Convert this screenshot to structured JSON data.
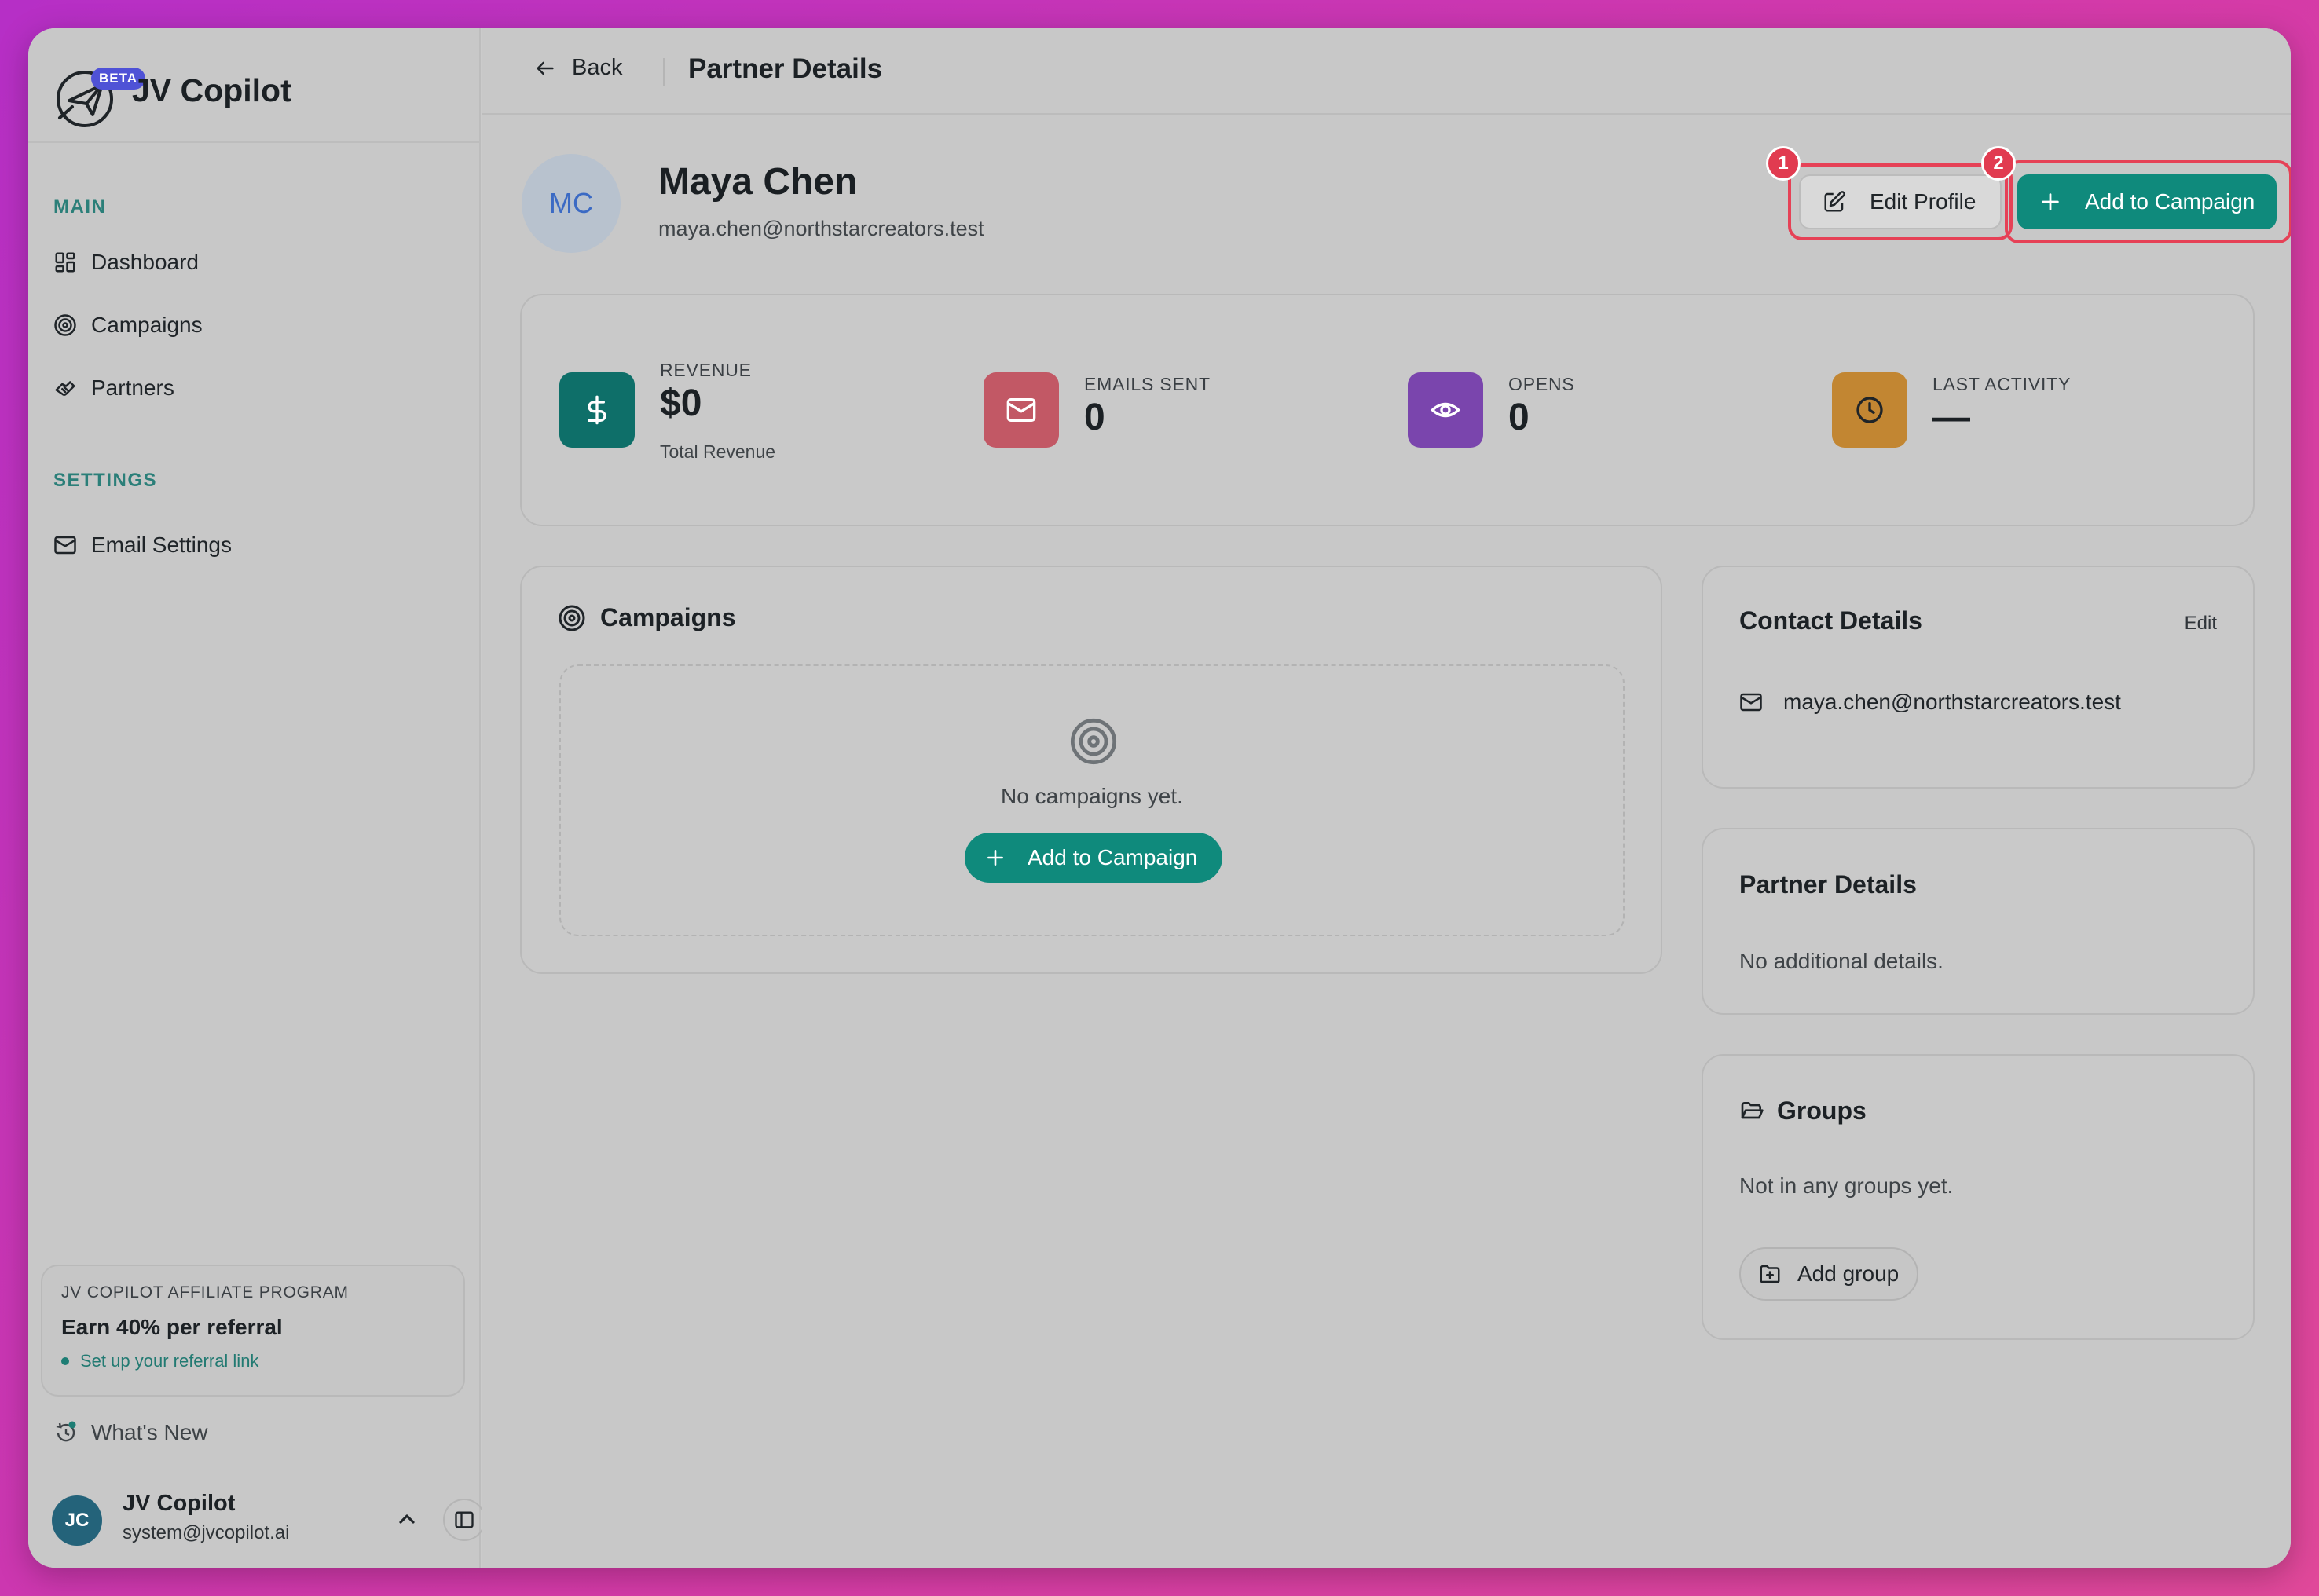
{
  "app": {
    "name": "JV Copilot",
    "beta_badge": "BETA"
  },
  "sidebar": {
    "main_label": "MAIN",
    "settings_label": "SETTINGS",
    "items": [
      {
        "label": "Dashboard",
        "icon": "dashboard-icon"
      },
      {
        "label": "Campaigns",
        "icon": "target-icon"
      },
      {
        "label": "Partners",
        "icon": "handshake-icon"
      }
    ],
    "settings_items": [
      {
        "label": "Email Settings",
        "icon": "mail-icon"
      }
    ],
    "affiliate": {
      "title": "JV COPILOT AFFILIATE PROGRAM",
      "headline": "Earn 40% per referral",
      "link": "Set up your referral link"
    },
    "whats_new": "What's New",
    "user": {
      "initials": "JC",
      "name": "JV Copilot",
      "email": "system@jvcopilot.ai"
    }
  },
  "header": {
    "back_label": "Back",
    "title": "Partner Details"
  },
  "profile": {
    "initials": "MC",
    "name": "Maya Chen",
    "email": "maya.chen@northstarcreators.test",
    "edit_button": "Edit Profile",
    "add_button": "Add to Campaign",
    "annotation_1": "1",
    "annotation_2": "2"
  },
  "stats": [
    {
      "label": "REVENUE",
      "value": "$0",
      "sub": "Total Revenue",
      "icon": "dollar-icon",
      "color": "#0e6f69"
    },
    {
      "label": "EMAILS SENT",
      "value": "0",
      "icon": "mail-icon",
      "color": "#c25865"
    },
    {
      "label": "OPENS",
      "value": "0",
      "icon": "eye-icon",
      "color": "#7a45ad"
    },
    {
      "label": "LAST ACTIVITY",
      "value": "—",
      "icon": "clock-icon",
      "color": "#c28632"
    }
  ],
  "campaigns": {
    "title": "Campaigns",
    "empty_text": "No campaigns yet.",
    "add_button": "Add to Campaign"
  },
  "contact": {
    "title": "Contact Details",
    "edit_label": "Edit",
    "email": "maya.chen@northstarcreators.test"
  },
  "partner_details": {
    "title": "Partner Details",
    "empty_text": "No additional details."
  },
  "groups": {
    "title": "Groups",
    "empty_text": "Not in any groups yet.",
    "add_button": "Add group"
  },
  "colors": {
    "accent": "#0f8a7c",
    "annotation": "#e13b50",
    "beta": "#4f52d6"
  }
}
